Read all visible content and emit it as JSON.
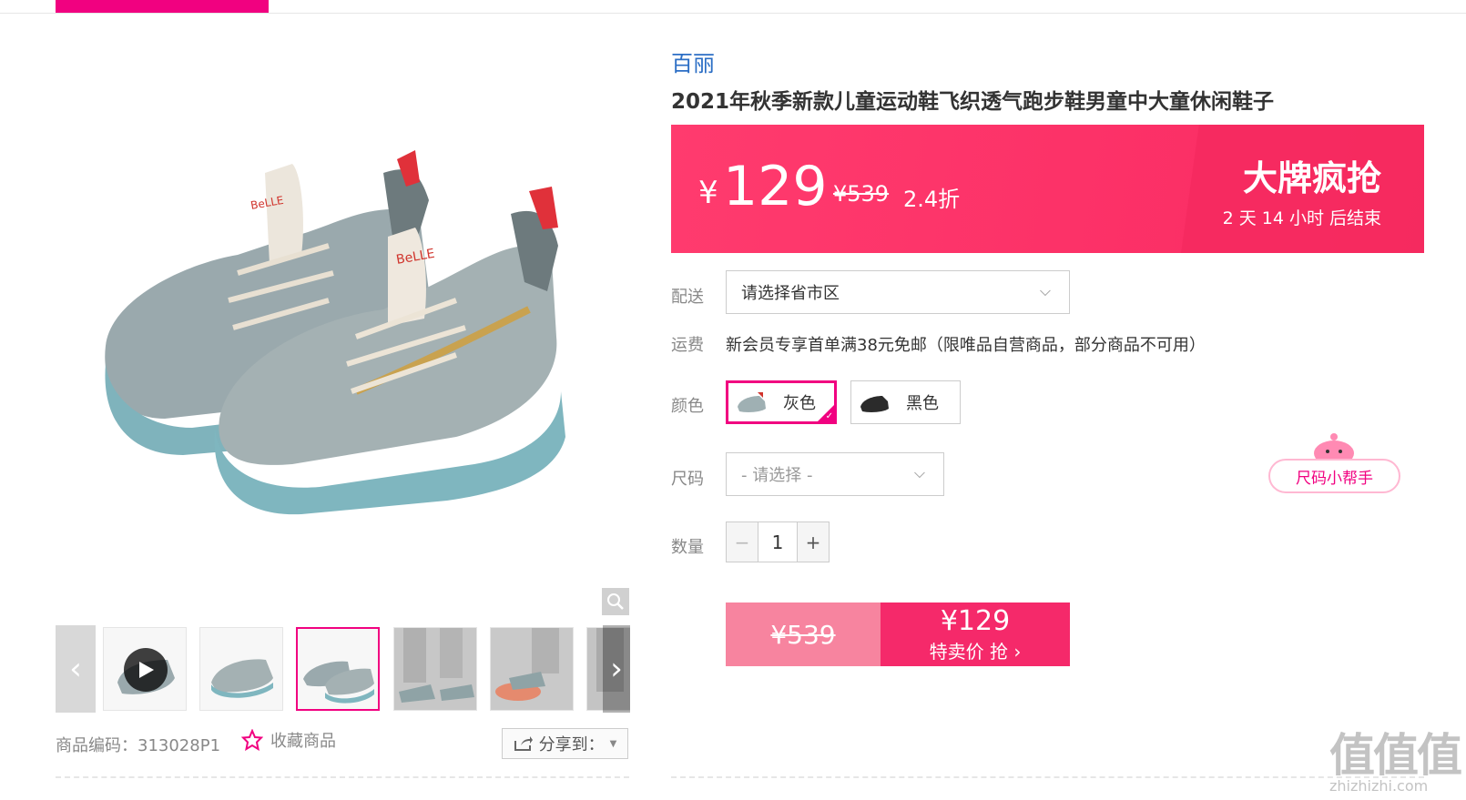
{
  "product": {
    "brand": "百丽",
    "title": "2021年秋季新款儿童运动鞋飞织透气跑步鞋男童中大童休闲鞋子",
    "sku_label": "商品编码：313028P1",
    "favorite_label": "收藏商品",
    "share_label": "分享到："
  },
  "price": {
    "currency": "¥",
    "current": "129",
    "original": "¥539",
    "discount": "2.4折",
    "promo_title": "大牌疯抢",
    "countdown": "2 天 14 小时 后结束"
  },
  "delivery": {
    "label": "配送",
    "placeholder": "请选择省市区"
  },
  "shipping": {
    "label": "运费",
    "text": "新会员专享首单满38元免邮（限唯品自营商品，部分商品不可用）"
  },
  "color": {
    "label": "颜色",
    "options": [
      {
        "name": "灰色",
        "selected": true
      },
      {
        "name": "黑色",
        "selected": false
      }
    ]
  },
  "size": {
    "label": "尺码",
    "placeholder": "- 请选择 -",
    "helper": "尺码小帮手"
  },
  "quantity": {
    "label": "数量",
    "value": "1",
    "minus": "−",
    "plus": "+"
  },
  "buy": {
    "original": "¥539",
    "price": "¥129",
    "action": "特卖价 抢 ›"
  },
  "watermark": {
    "big": "值值值",
    "small": "zhizhizhi.com"
  },
  "colors": {
    "accent": "#f10180",
    "price_bar": "#fb2f66",
    "brand_link": "#2b6ec5"
  }
}
